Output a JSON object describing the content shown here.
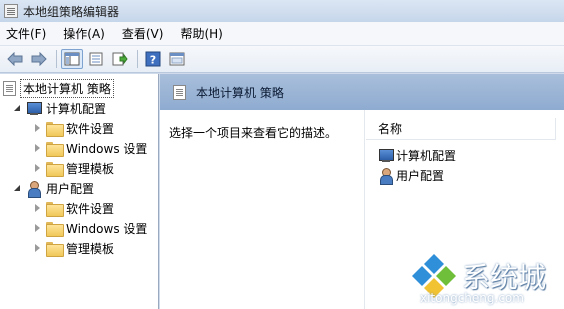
{
  "window": {
    "title": "本地组策略编辑器"
  },
  "menu": [
    "文件(F)",
    "操作(A)",
    "查看(V)",
    "帮助(H)"
  ],
  "toolbar": {
    "buttons": [
      "back-icon",
      "forward-icon",
      "show-hide-tree-icon",
      "properties-icon",
      "export-list-icon",
      "help-icon",
      "filter-icon"
    ]
  },
  "tree": {
    "root": "本地计算机 策略",
    "computer": {
      "label": "计算机配置",
      "children": [
        "软件设置",
        "Windows 设置",
        "管理模板"
      ]
    },
    "user": {
      "label": "用户配置",
      "children": [
        "软件设置",
        "Windows 设置",
        "管理模板"
      ]
    }
  },
  "main": {
    "header": "本地计算机 策略",
    "description": "选择一个项目来查看它的描述。",
    "column_name": "名称",
    "items": [
      "计算机配置",
      "用户配置"
    ]
  },
  "watermark": {
    "title": "系统城",
    "url": "xitongcheng.com"
  },
  "colors": {
    "accent": "#8eabd0",
    "folder": "#f0c859",
    "titlebar": "#c6d6ea"
  }
}
